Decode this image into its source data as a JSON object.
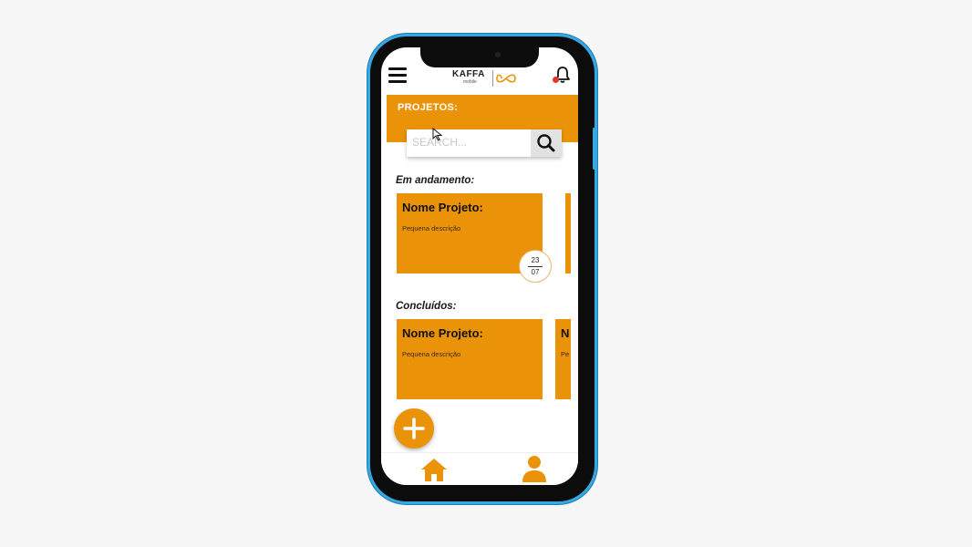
{
  "app": {
    "logo_text": "KAFFA",
    "logo_subtext": "mobile"
  },
  "header": {
    "title": "PROJETOS:"
  },
  "search": {
    "placeholder": "SEARCH..."
  },
  "sections": {
    "in_progress_label": "Em andamento:",
    "completed_label": "Concluídos:"
  },
  "in_progress_cards": [
    {
      "title": "Nome Projeto:",
      "description": "Pequena descrição",
      "date_day": "23",
      "date_month": "07"
    }
  ],
  "completed_cards": [
    {
      "title": "Nome Projeto:",
      "description": "Pequena descrição"
    }
  ],
  "completed_peek": {
    "title_initial": "N",
    "description_initial": "Pe"
  },
  "icons": {
    "menu": "hamburger-menu-icon",
    "bell": "bell-icon",
    "search": "search-icon",
    "add": "plus-icon",
    "home": "home-icon",
    "profile": "user-icon"
  },
  "colors": {
    "accent": "#eb9308",
    "phone_frame": "#36a7e0",
    "notification": "#e03a2c"
  }
}
